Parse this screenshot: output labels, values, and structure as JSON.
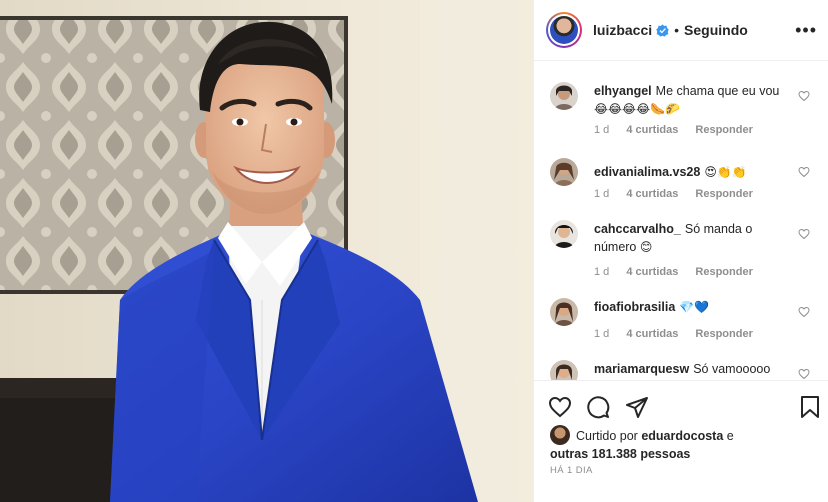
{
  "post": {
    "username": "luizbacci",
    "separator": "•",
    "follow_status": "Seguindo",
    "more_label": "•••"
  },
  "comments": [
    {
      "user": "elhyangel",
      "text": "Me chama que eu vou",
      "emoji": "😂😂😂😂🌭🌮",
      "age": "1 d",
      "likes": "4 curtidas",
      "reply": "Responder"
    },
    {
      "user": "edivanialima.vs28",
      "text": "",
      "emoji": "😍👏👏",
      "age": "1 d",
      "likes": "4 curtidas",
      "reply": "Responder"
    },
    {
      "user": "cahccarvalho_",
      "text": "Só manda o número",
      "emoji": "😊",
      "age": "1 d",
      "likes": "4 curtidas",
      "reply": "Responder"
    },
    {
      "user": "fioafiobrasilia",
      "text": "",
      "emoji": "💎💙",
      "age": "1 d",
      "likes": "4 curtidas",
      "reply": "Responder"
    },
    {
      "user": "mariamarquesw",
      "text": "Só vamooooo",
      "emoji": "",
      "age": "",
      "likes": "",
      "reply": ""
    }
  ],
  "likes": {
    "prefix": "Curtido por",
    "user": "eduardocosta",
    "suffix": "e",
    "others": "outras 181.388 pessoas"
  },
  "timestamp": "HÁ 1 DIA",
  "colors": {
    "jacket": "#2a45c6",
    "verified": "#3897f0",
    "muted": "#8e8e8e",
    "wall": "#e7dfcf"
  },
  "icons": [
    "verified-badge-icon",
    "more-options-icon",
    "heart-icon",
    "comment-icon",
    "share-icon",
    "bookmark-icon"
  ]
}
